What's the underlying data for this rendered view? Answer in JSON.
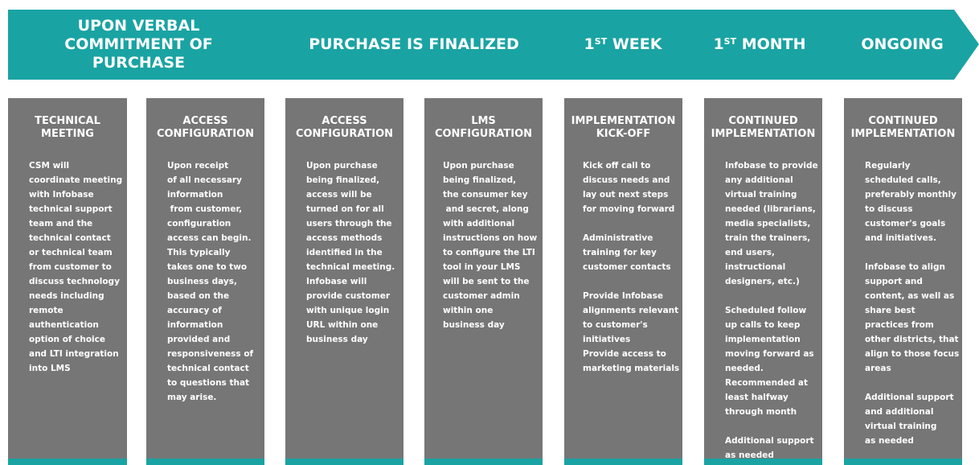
{
  "colors": {
    "teal": "#1aa3a3",
    "column_gray": "#767676",
    "text": "#ffffff"
  },
  "phases": [
    {
      "lines": [
        "UPON VERBAL",
        "COMMITMENT OF",
        "PURCHASE"
      ]
    },
    {
      "lines": [
        "PURCHASE IS FINALIZED"
      ]
    },
    {
      "ordinal": "1",
      "suffix": "ST",
      "rest": " WEEK"
    },
    {
      "ordinal": "1",
      "suffix": "ST",
      "rest": " MONTH"
    },
    {
      "lines": [
        "ONGOING"
      ]
    }
  ],
  "columns": [
    {
      "title": [
        "TECHNICAL",
        "MEETING"
      ],
      "body": [
        [
          "CSM will",
          "coordinate meeting",
          "with Infobase",
          "technical support",
          "team and the",
          "technical contact",
          "or technical team",
          "from customer to",
          "discuss technology",
          "needs including",
          "remote",
          "authentication",
          "option of choice",
          "and LTI integration",
          "into LMS"
        ]
      ]
    },
    {
      "title": [
        "ACCESS",
        "CONFIGURATION"
      ],
      "body": [
        [
          "Upon receipt",
          "of all necessary",
          "information",
          " from customer,",
          "configuration",
          "access can begin.",
          "This typically",
          "takes one to two",
          "business days,",
          "based on the",
          "accuracy of",
          "information",
          "provided and",
          "responsiveness of",
          "technical contact",
          "to questions that",
          "may arise."
        ]
      ]
    },
    {
      "title": [
        "ACCESS",
        "CONFIGURATION"
      ],
      "body": [
        [
          "Upon purchase",
          "being finalized,",
          "access will be",
          "turned on for all",
          "users through the",
          "access methods",
          "identified in the",
          "technical meeting.",
          "Infobase will",
          "provide customer",
          "with unique login",
          "URL within one",
          "business day"
        ]
      ]
    },
    {
      "title": [
        "LMS",
        "CONFIGURATION"
      ],
      "body": [
        [
          "Upon purchase",
          "being finalized,",
          "the consumer key",
          " and secret, along",
          "with additional",
          "instructions on how",
          "to configure the LTI",
          "tool in your LMS",
          "will be sent to the",
          "customer admin",
          "within one",
          "business day"
        ]
      ]
    },
    {
      "title": [
        "IMPLEMENTATION",
        "KICK-OFF"
      ],
      "body": [
        [
          "Kick off call to",
          "discuss needs and",
          "lay out next steps",
          "for moving forward"
        ],
        [
          "Administrative",
          "training for key",
          "customer contacts"
        ],
        [
          "Provide Infobase",
          "alignments relevant",
          "to customer's",
          "initiatives",
          "Provide access to",
          "marketing materials"
        ]
      ]
    },
    {
      "title": [
        "CONTINUED",
        "IMPLEMENTATION"
      ],
      "body": [
        [
          "Infobase to provide",
          "any additional",
          "virtual training",
          "needed (librarians,",
          "media specialists,",
          "train the trainers,",
          "end users,",
          "instructional",
          "designers, etc.)"
        ],
        [
          "Scheduled follow",
          "up calls to keep",
          "implementation",
          "moving forward as",
          "needed.",
          "Recommended at",
          "least halfway",
          "through month"
        ],
        [
          "Additional support",
          "as needed"
        ]
      ]
    },
    {
      "title": [
        "CONTINUED",
        "IMPLEMENTATION"
      ],
      "body": [
        [
          "Regularly",
          "scheduled calls,",
          "preferably monthly",
          "to discuss",
          "customer's goals",
          "and initiatives."
        ],
        [
          "Infobase to align",
          "support and",
          "content, as well as",
          "share best",
          "practices from",
          "other districts, that",
          "align to those focus",
          "areas"
        ],
        [
          "Additional support",
          "and additional",
          "virtual training",
          "as needed"
        ]
      ]
    }
  ]
}
